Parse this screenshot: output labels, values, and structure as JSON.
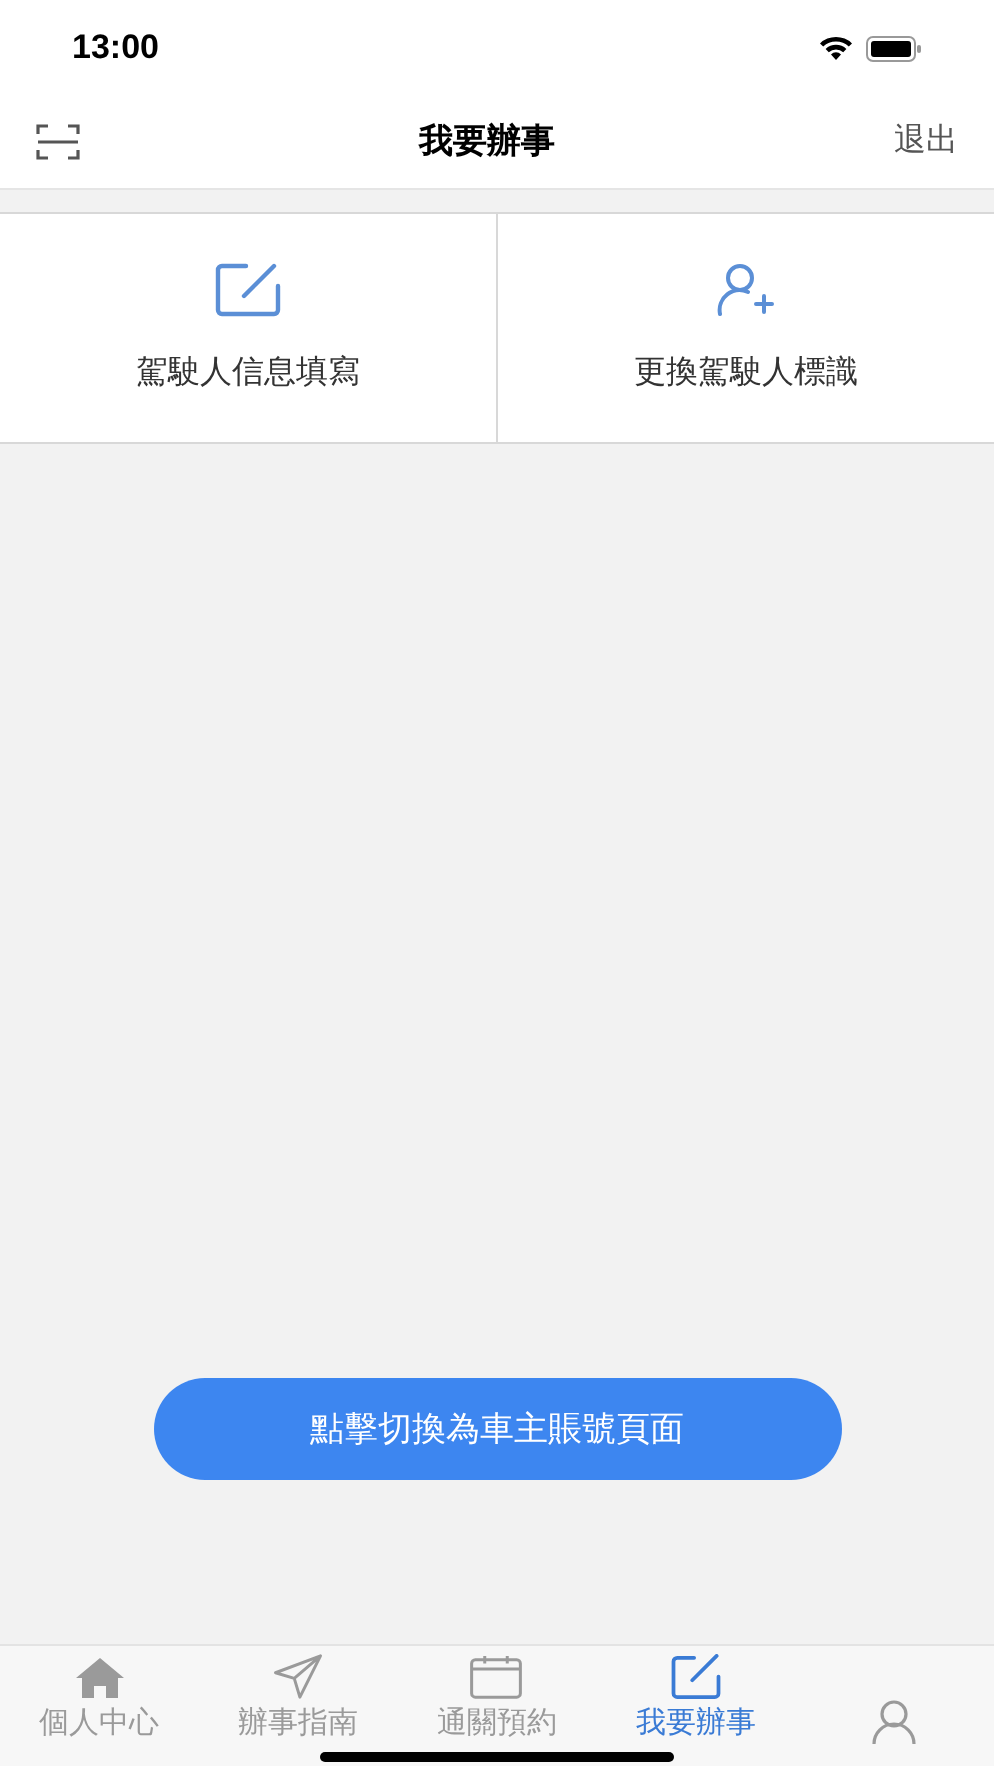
{
  "status_bar": {
    "time": "13:00"
  },
  "header": {
    "title": "我要辦事",
    "action": "退出"
  },
  "services": [
    {
      "kind": "edit",
      "label": "駕駛人信息填寫"
    },
    {
      "kind": "add-person",
      "label": "更換駕駛人標識"
    }
  ],
  "switch_button": {
    "label": "點擊切換為車主賬號頁面"
  },
  "tabs": [
    {
      "kind": "home",
      "label": "個人中心",
      "selected": false
    },
    {
      "kind": "send",
      "label": "辦事指南",
      "selected": false
    },
    {
      "kind": "calendar",
      "label": "通關預約",
      "selected": false
    },
    {
      "kind": "edit",
      "label": "我要辦事",
      "selected": true
    },
    {
      "kind": "person",
      "selected": false
    }
  ]
}
